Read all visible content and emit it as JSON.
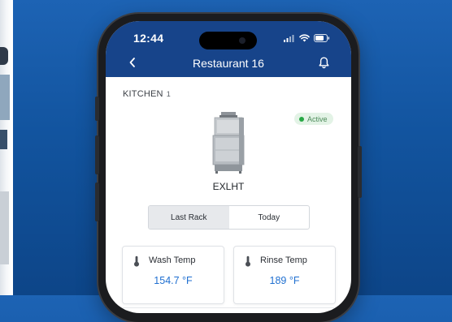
{
  "status_bar": {
    "time": "12:44"
  },
  "header": {
    "title": "Restaurant 16"
  },
  "section": {
    "label": "KITCHEN",
    "count": "1"
  },
  "device": {
    "status": "Active",
    "model": "EXLHT"
  },
  "tabs": [
    {
      "label": "Last Rack",
      "active": true
    },
    {
      "label": "Today",
      "active": false
    }
  ],
  "metrics": [
    {
      "label": "Wash Temp",
      "value": "154.7 °F",
      "icon": "thermometer-icon"
    },
    {
      "label": "Rinse Temp",
      "value": "189 °F",
      "icon": "thermometer-icon"
    }
  ],
  "colors": {
    "header": "#17448a",
    "accent": "#1f6fd0",
    "active": "#27a845"
  }
}
